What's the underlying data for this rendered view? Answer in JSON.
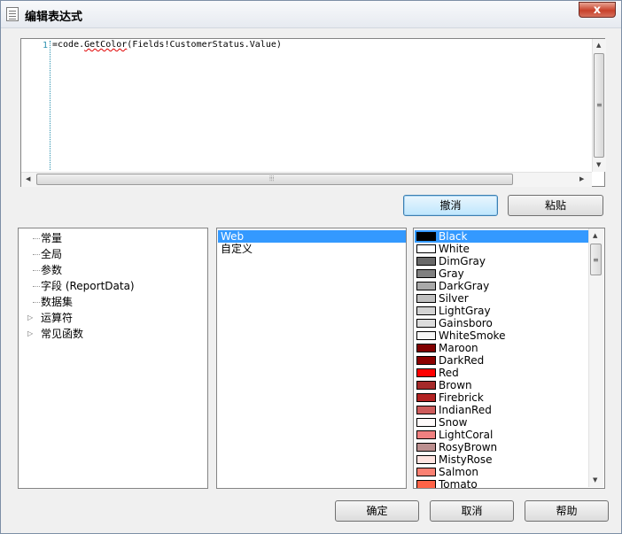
{
  "window": {
    "title": "编辑表达式",
    "close_glyph": "x"
  },
  "editor": {
    "line_number": "1",
    "code_prefix": "=code.",
    "code_error": "GetColor",
    "code_suffix": "(Fields!CustomerStatus.Value)"
  },
  "toolbar": {
    "undo_label": "撤消",
    "paste_label": "粘贴"
  },
  "tree": {
    "items": [
      {
        "label": "常量",
        "expandable": false
      },
      {
        "label": "全局",
        "expandable": false
      },
      {
        "label": "参数",
        "expandable": false
      },
      {
        "label": "字段 (ReportData)",
        "expandable": false
      },
      {
        "label": "数据集",
        "expandable": false
      },
      {
        "label": "运算符",
        "expandable": true
      },
      {
        "label": "常见函数",
        "expandable": true
      }
    ]
  },
  "categories": {
    "items": [
      {
        "label": "Web",
        "selected": true
      },
      {
        "label": "自定义",
        "selected": false
      }
    ]
  },
  "colors": {
    "items": [
      {
        "name": "Black",
        "hex": "#000000",
        "selected": true
      },
      {
        "name": "White",
        "hex": "#ffffff"
      },
      {
        "name": "DimGray",
        "hex": "#696969"
      },
      {
        "name": "Gray",
        "hex": "#808080"
      },
      {
        "name": "DarkGray",
        "hex": "#a9a9a9"
      },
      {
        "name": "Silver",
        "hex": "#c0c0c0"
      },
      {
        "name": "LightGray",
        "hex": "#d3d3d3"
      },
      {
        "name": "Gainsboro",
        "hex": "#dcdcdc"
      },
      {
        "name": "WhiteSmoke",
        "hex": "#f5f5f5"
      },
      {
        "name": "Maroon",
        "hex": "#800000"
      },
      {
        "name": "DarkRed",
        "hex": "#8b0000"
      },
      {
        "name": "Red",
        "hex": "#ff0000"
      },
      {
        "name": "Brown",
        "hex": "#a52a2a"
      },
      {
        "name": "Firebrick",
        "hex": "#b22222"
      },
      {
        "name": "IndianRed",
        "hex": "#cd5c5c"
      },
      {
        "name": "Snow",
        "hex": "#fffafa"
      },
      {
        "name": "LightCoral",
        "hex": "#f08080"
      },
      {
        "name": "RosyBrown",
        "hex": "#bc8f8f"
      },
      {
        "name": "MistyRose",
        "hex": "#ffe4e1"
      },
      {
        "name": "Salmon",
        "hex": "#fa8072"
      },
      {
        "name": "Tomato",
        "hex": "#ff6347"
      }
    ]
  },
  "footer": {
    "ok_label": "确定",
    "cancel_label": "取消",
    "help_label": "帮助"
  }
}
